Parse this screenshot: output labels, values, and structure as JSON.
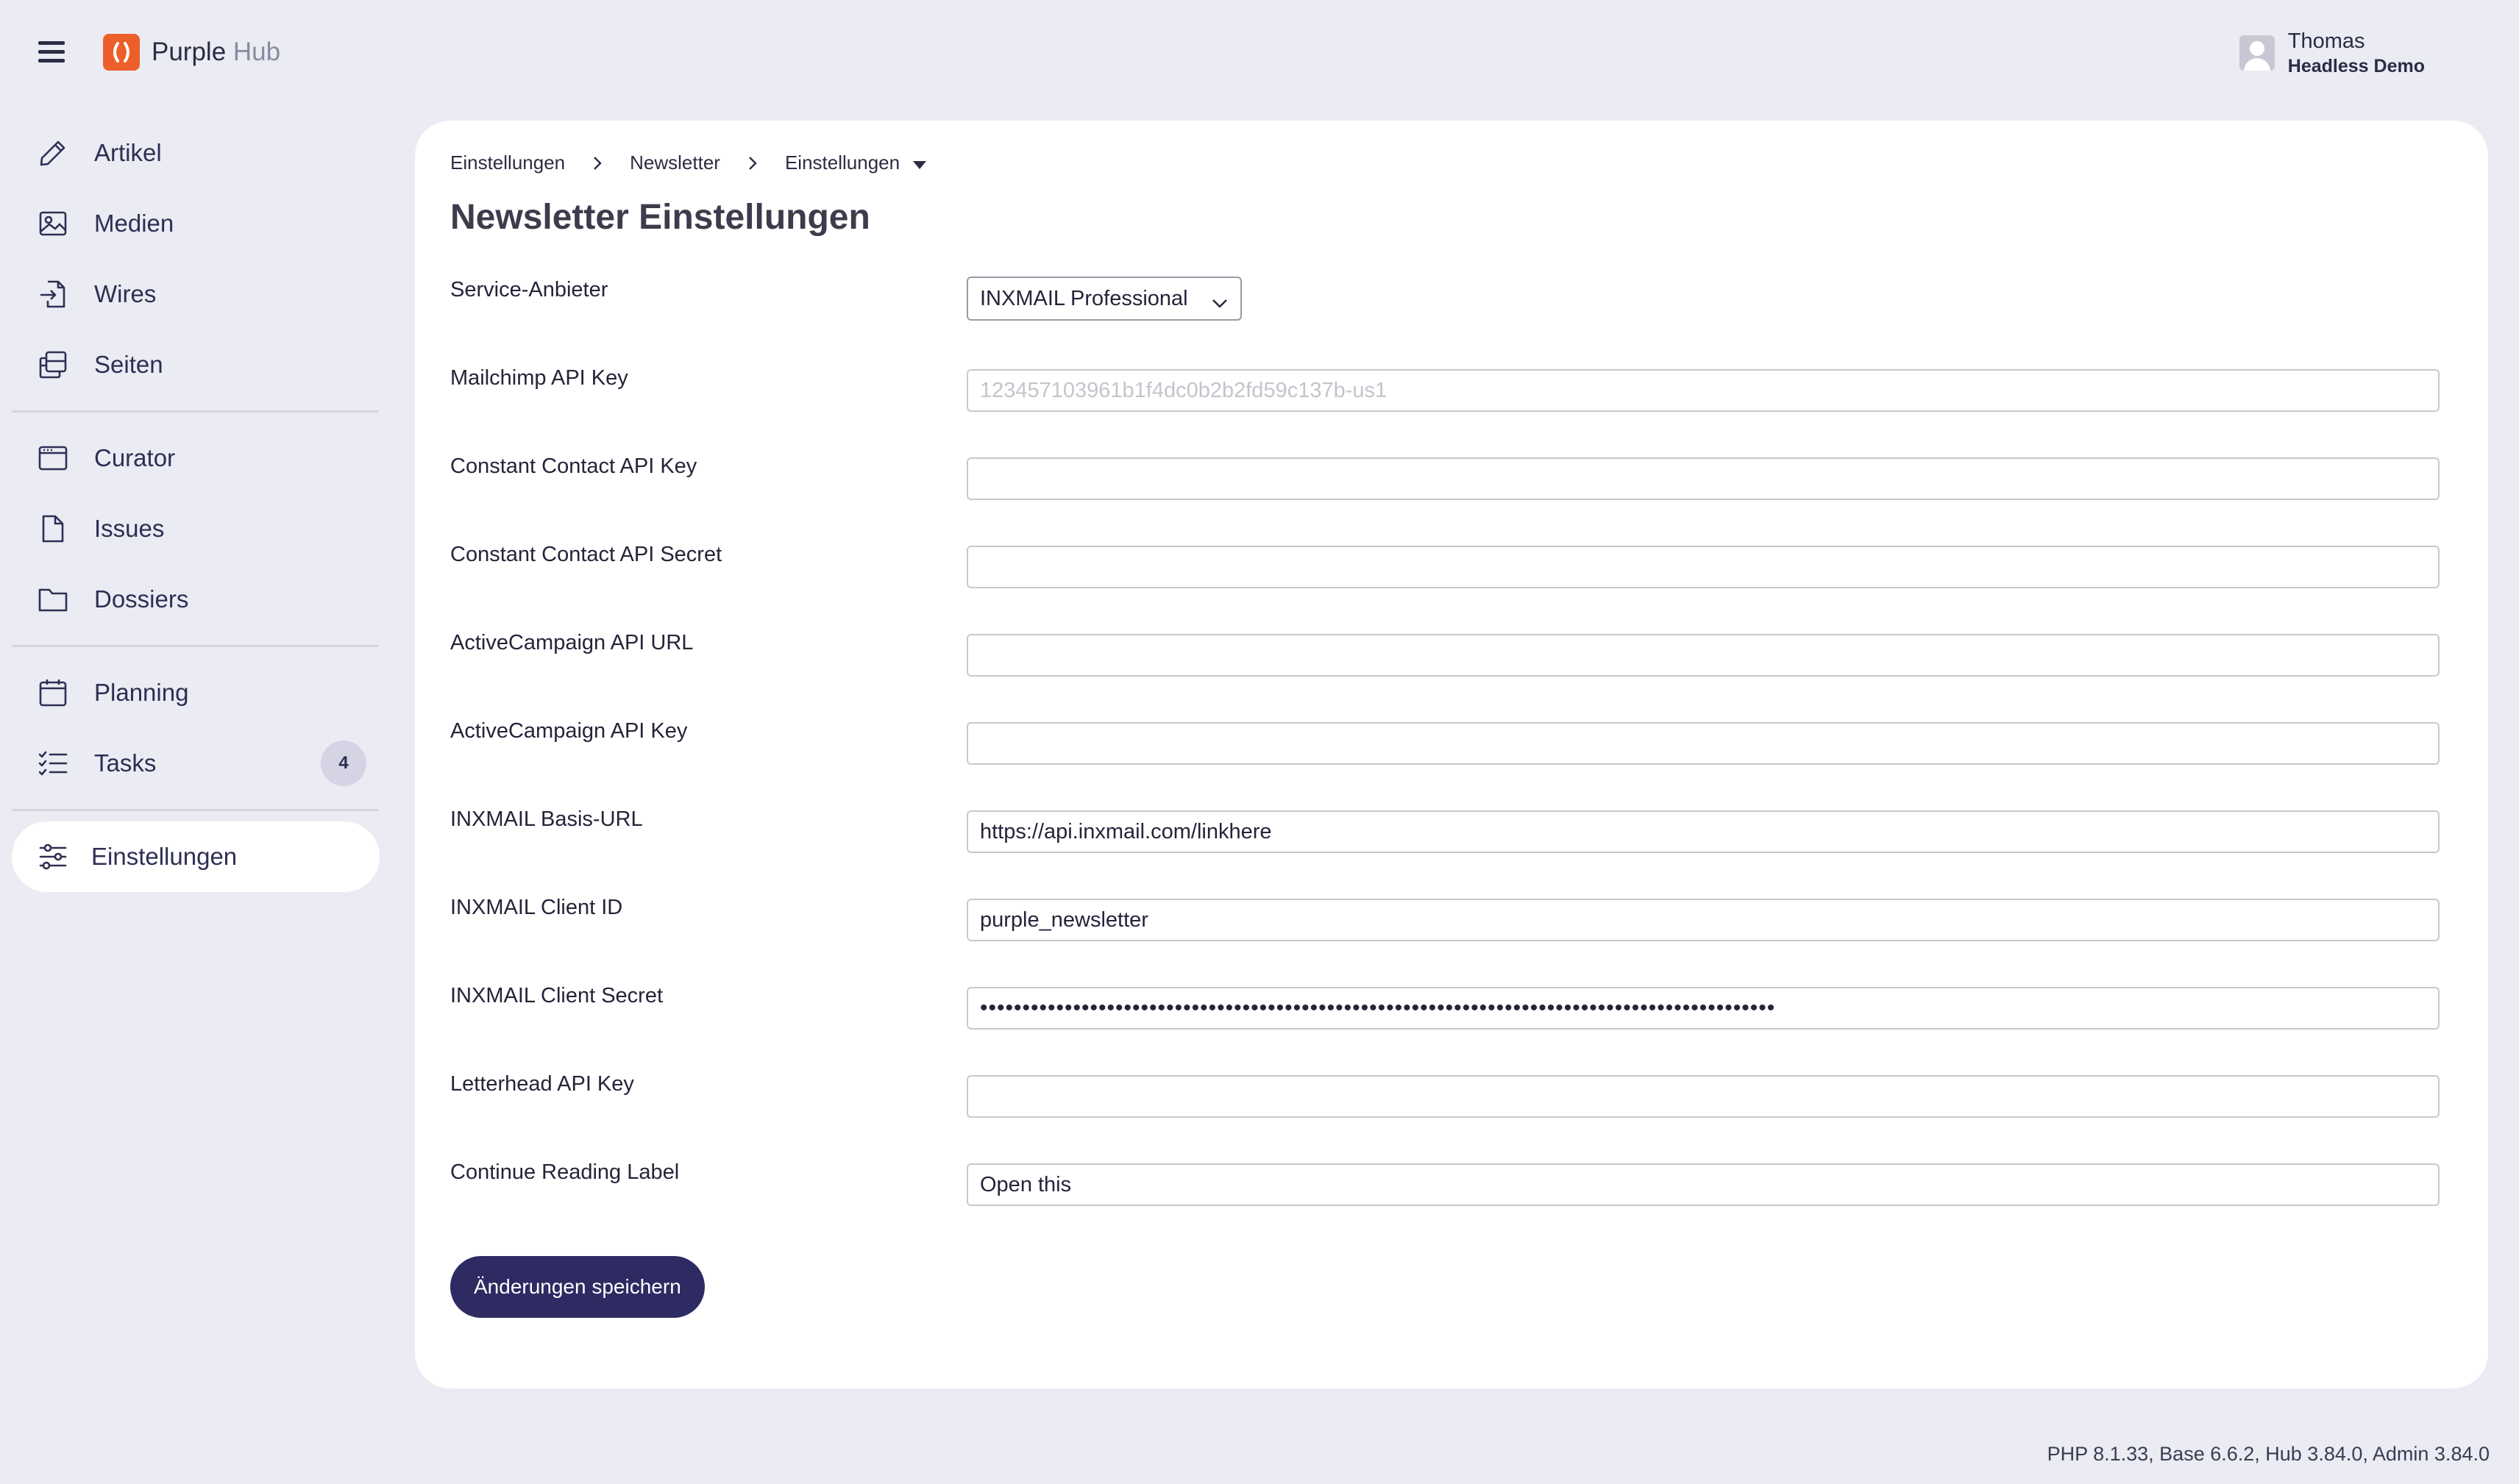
{
  "app": {
    "brand_primary": "Purple",
    "brand_secondary": "Hub",
    "brand_color": "#ec5f2a",
    "accent_color": "#2e2a62"
  },
  "user": {
    "name": "Thomas",
    "organization": "Headless Demo"
  },
  "sidebar": {
    "items": [
      {
        "label": "Artikel",
        "icon": "pencil-icon"
      },
      {
        "label": "Medien",
        "icon": "image-icon"
      },
      {
        "label": "Wires",
        "icon": "import-file-icon"
      },
      {
        "label": "Seiten",
        "icon": "pages-icon"
      },
      {
        "label": "Curator",
        "icon": "browser-window-icon"
      },
      {
        "label": "Issues",
        "icon": "document-icon"
      },
      {
        "label": "Dossiers",
        "icon": "folder-icon"
      },
      {
        "label": "Planning",
        "icon": "calendar-icon"
      },
      {
        "label": "Tasks",
        "icon": "checklist-icon",
        "badge": "4"
      },
      {
        "label": "Einstellungen",
        "icon": "sliders-icon",
        "active": true
      }
    ]
  },
  "breadcrumb": [
    "Einstellungen",
    "Newsletter",
    "Einstellungen"
  ],
  "page": {
    "title": "Newsletter Einstellungen"
  },
  "form": {
    "service_provider": {
      "label": "Service-Anbieter",
      "value": "INXMAIL Professional"
    },
    "fields": [
      {
        "label": "Mailchimp API Key",
        "value": "",
        "placeholder": "123457103961b1f4dc0b2b2fd59c137b-us1"
      },
      {
        "label": "Constant Contact API Key",
        "value": "",
        "placeholder": ""
      },
      {
        "label": "Constant Contact API Secret",
        "value": "",
        "placeholder": ""
      },
      {
        "label": "ActiveCampaign API URL",
        "value": "",
        "placeholder": ""
      },
      {
        "label": "ActiveCampaign API Key",
        "value": "",
        "placeholder": ""
      },
      {
        "label": "INXMAIL Basis-URL",
        "value": "https://api.inxmail.com/linkhere",
        "placeholder": ""
      },
      {
        "label": "INXMAIL Client ID",
        "value": "purple_newsletter",
        "placeholder": ""
      },
      {
        "label": "INXMAIL Client Secret",
        "value": "••••••••••••••••••••••••••••••••••••••••••••••••••••••••••••••••••••••••••••••••••••••••••••••",
        "placeholder": ""
      },
      {
        "label": "Letterhead API Key",
        "value": "",
        "placeholder": ""
      },
      {
        "label": "Continue Reading Label",
        "value": "Open this",
        "placeholder": ""
      }
    ],
    "save_label": "Änderungen speichern"
  },
  "footer": {
    "version": "PHP 8.1.33, Base 6.6.2, Hub 3.84.0, Admin 3.84.0"
  }
}
